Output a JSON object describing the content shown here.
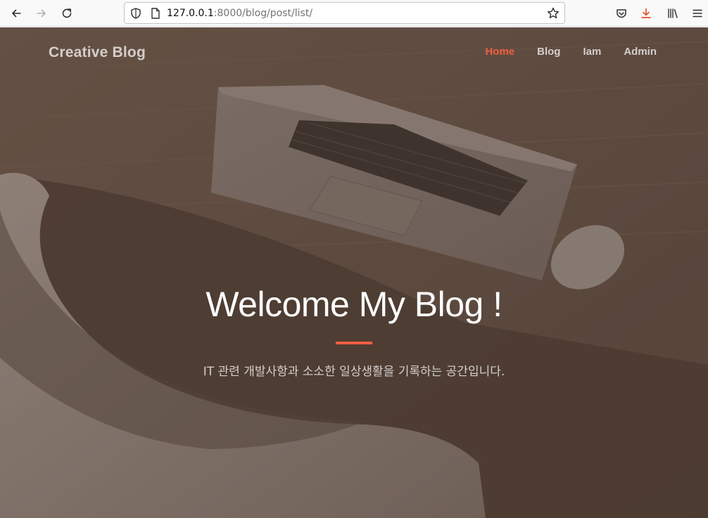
{
  "browser": {
    "url_host": "127.0.0.1",
    "url_path": ":8000/blog/post/list/"
  },
  "icons": {
    "back": "arrow-left-icon",
    "forward": "arrow-right-icon",
    "reload": "reload-icon",
    "tracking": "shield-icon",
    "page": "page-icon",
    "bookmark": "star-icon",
    "pocket": "pocket-icon",
    "downloads": "download-icon",
    "library": "library-icon",
    "menu": "hamburger-menu-icon"
  },
  "colors": {
    "accent": "#f05f40",
    "download_active": "#e8542b"
  },
  "site": {
    "brand": "Creative Blog",
    "nav": [
      {
        "label": "Home",
        "active": true
      },
      {
        "label": "Blog",
        "active": false
      },
      {
        "label": "Iam",
        "active": false
      },
      {
        "label": "Admin",
        "active": false
      }
    ]
  },
  "hero": {
    "title": "Welcome My Blog !",
    "subtitle": "IT 관련 개발사항과 소소한 일상생활을 기록하는 공간입니다."
  }
}
